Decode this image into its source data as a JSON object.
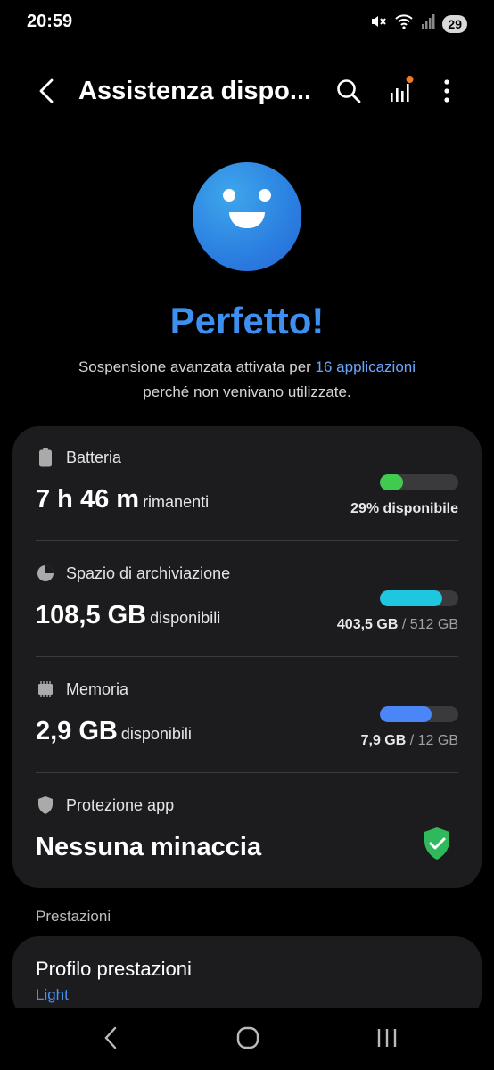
{
  "status_bar": {
    "time": "20:59",
    "battery_level": "29",
    "icons": [
      "mute-icon",
      "wifi-icon",
      "signal-icon"
    ]
  },
  "app_bar": {
    "title": "Assistenza dispo...",
    "icons": [
      "back-icon",
      "search-icon",
      "stats-icon",
      "more-icon"
    ],
    "notification_dot_color": "#f07a2a"
  },
  "status": {
    "headline": "Perfetto!",
    "desc_part1": "Sospensione avanzata attivata per ",
    "desc_link": "16 applicazioni",
    "desc_part2": "perché non venivano utilizzate."
  },
  "battery": {
    "label": "Batteria",
    "value": "7 h 46 m",
    "unit": "rimanenti",
    "status": "29% disponibile",
    "fill_fraction": 0.29,
    "color": "#3ecb4f"
  },
  "storage": {
    "label": "Spazio di archiviazione",
    "value": "108,5 GB",
    "unit": "disponibili",
    "used": "403,5 GB",
    "separator": " / ",
    "total": "512 GB",
    "fill_fraction": 0.79,
    "color": "#1fc6e0"
  },
  "memory": {
    "label": "Memoria",
    "value": "2,9 GB",
    "unit": "disponibili",
    "used": "7,9 GB",
    "separator": " / ",
    "total": "12 GB",
    "fill_fraction": 0.66,
    "color": "#4a86f7"
  },
  "protection": {
    "label": "Protezione app",
    "value": "Nessuna minaccia",
    "color": "#2fb85c"
  },
  "section": {
    "label": "Prestazioni"
  },
  "performance": {
    "title": "Profilo prestazioni",
    "value": "Light"
  },
  "nav": {
    "icons": [
      "nav-back-icon",
      "home-icon",
      "recents-icon"
    ]
  }
}
